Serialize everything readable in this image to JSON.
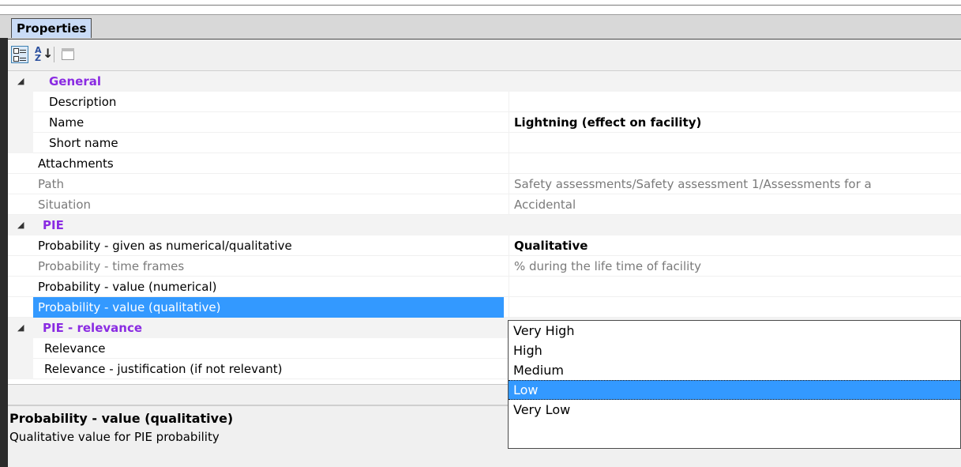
{
  "panel": {
    "tab_label": "Properties"
  },
  "toolbar": {
    "categorized_icon": "categorized-view-icon",
    "alphabetical_icon": "sort-alphabetical-icon",
    "property_pages_icon": "property-pages-icon",
    "alphabetical_glyph": "A\nZ"
  },
  "categories": {
    "general": {
      "label": "General",
      "rows": [
        {
          "name": "Description",
          "value": ""
        },
        {
          "name": "Name",
          "value": "Lightning (effect on facility)"
        },
        {
          "name": "Short name",
          "value": ""
        }
      ]
    },
    "general_extra": [
      {
        "name": "Attachments",
        "value": ""
      },
      {
        "name": "Path",
        "value": "Safety assessments/Safety assessment 1/Assessments for a"
      },
      {
        "name": "Situation",
        "value": "Accidental"
      }
    ],
    "pie": {
      "label": "PIE",
      "rows": [
        {
          "name": "Probability - given as numerical/qualitative",
          "value": "Qualitative"
        },
        {
          "name": "Probability - time frames",
          "value": "% during the life time of facility"
        },
        {
          "name": "Probability - value (numerical)",
          "value": ""
        },
        {
          "name": "Probability - value (qualitative)",
          "value": ""
        }
      ]
    },
    "pie_relevance": {
      "label": "PIE - relevance",
      "rows": [
        {
          "name": "Relevance",
          "value": ""
        },
        {
          "name": "Relevance - justification (if not relevant)",
          "value": ""
        }
      ]
    }
  },
  "dropdown": {
    "options": [
      "Very High",
      "High",
      "Medium",
      "Low",
      "Very Low"
    ],
    "highlighted": "Low"
  },
  "description": {
    "title": "Probability - value (qualitative)",
    "text": "Qualitative value for PIE probability"
  },
  "colors": {
    "category_text": "#8a2be2",
    "selection": "#3399ff",
    "tab_bg": "#c9dbf6"
  }
}
